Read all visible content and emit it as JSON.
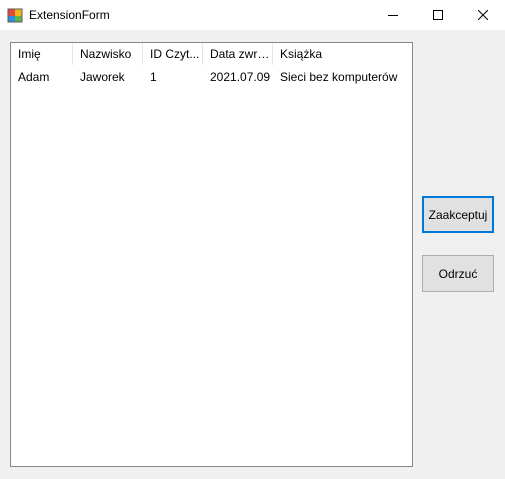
{
  "window": {
    "title": "ExtensionForm"
  },
  "listview": {
    "columns": [
      "Imię",
      "Nazwisko",
      "ID Czyt...",
      "Data zwrotu",
      "Książka"
    ],
    "rows": [
      [
        "Adam",
        "Jaworek",
        "1",
        "2021.07.09",
        "Sieci bez komputerów"
      ]
    ]
  },
  "buttons": {
    "accept": "Zaakceptuj",
    "reject": "Odrzuć"
  },
  "icons": {
    "app": "app-form-icon",
    "minimize": "minimize-icon",
    "maximize": "maximize-icon",
    "close": "close-icon"
  },
  "colors": {
    "focus_border": "#0078d7",
    "button_face": "#e1e1e1",
    "window_bg": "#f0f0f0"
  }
}
